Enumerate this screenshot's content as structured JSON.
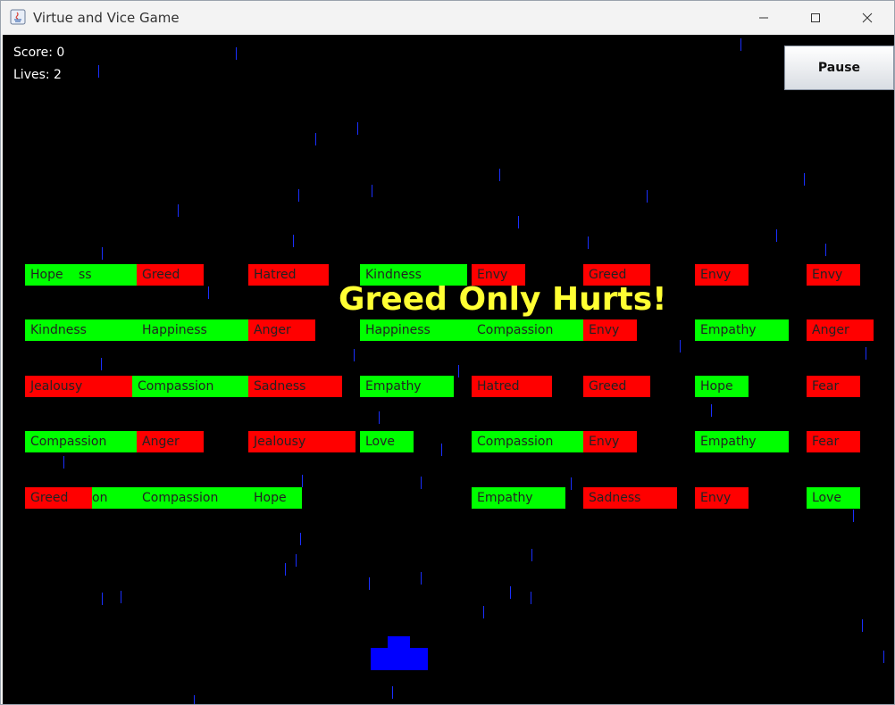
{
  "window": {
    "title": "Virtue and Vice Game"
  },
  "hud": {
    "score": "Score: 0",
    "lives": "Lives: 2",
    "pause_label": "Pause"
  },
  "message": "Greed Only Hurts!",
  "colors": {
    "virtue": "#00ff00",
    "vice": "#ff0000",
    "message": "#ffff33",
    "rain": "#1a2fff",
    "paddle": "#0000ff",
    "background": "#000000"
  },
  "bricks": {
    "r1": [
      "Hope",
      "ss",
      "Greed",
      "Hatred",
      "Kindness",
      "Envy",
      "Greed",
      "Envy",
      "Envy"
    ],
    "r2": [
      "Kindness",
      "Happiness",
      "Anger",
      "Happiness",
      "Compassion",
      "Envy",
      "Empathy",
      "Anger"
    ],
    "r3": [
      "Jealousy",
      "Compassion",
      "Sadness",
      "Empathy",
      "Hatred",
      "Greed",
      "Hope",
      "Fear"
    ],
    "r4": [
      "Compassion",
      "Anger",
      "Jealousy",
      "Love",
      "Compassion",
      "Envy",
      "Empathy",
      "Fear"
    ],
    "r5": [
      "Greed",
      "on",
      "Compassion",
      "Hope",
      "Empathy",
      "Sadness",
      "Envy",
      "Love"
    ]
  }
}
